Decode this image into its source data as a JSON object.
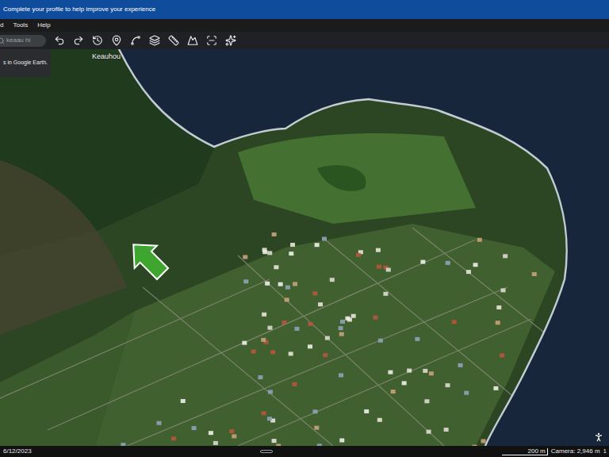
{
  "banner": {
    "text": "Complete your profile to help improve your experience"
  },
  "menu": [
    {
      "label": "d"
    },
    {
      "label": "Tools"
    },
    {
      "label": "Help"
    }
  ],
  "search": {
    "value": "keaau hi"
  },
  "side_panel": {
    "text": "s in Google Earth."
  },
  "map": {
    "labels": [
      {
        "text": "Keauhou"
      }
    ]
  },
  "status_bar": {
    "date": "6/12/2023",
    "scale": "200 m",
    "camera": "Camera: 2,946 m",
    "extra": "1"
  }
}
